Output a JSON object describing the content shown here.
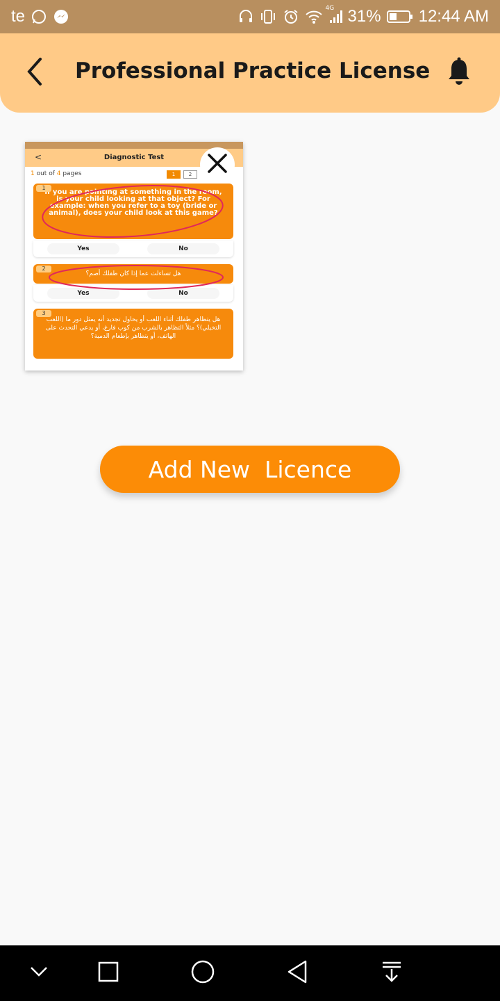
{
  "status_bar": {
    "carrier": "te",
    "network": "4G",
    "battery": "31%",
    "time": "12:44 AM",
    "left_icons": [
      "whatsapp-icon",
      "messenger-icon"
    ],
    "right_icons": [
      "headset-icon",
      "vibrate-icon",
      "alarm-icon",
      "wifi-icon",
      "signal-icon",
      "battery-icon"
    ]
  },
  "header": {
    "title": "Professional Practice License",
    "back_icon": "chevron-left-icon",
    "notification_icon": "bell-icon",
    "background": "#ffca87"
  },
  "license_thumbnail": {
    "title": "Diagnostic Test",
    "back": "<",
    "pager": {
      "current": "1",
      "middle": " out of ",
      "total": "4",
      "suffix": " pages",
      "pages": [
        "1",
        "2"
      ]
    },
    "questions": [
      {
        "number": "1",
        "text": "If you are pointing at something in the room, is your child looking at that object? For example: when you refer to a toy (bride or animal), does your child look at this game?",
        "answers": [
          "Yes",
          "No"
        ]
      },
      {
        "number": "2",
        "text": "هل تساءلت عما إذا كان طفلك أصم؟",
        "answers": [
          "Yes",
          "No"
        ]
      },
      {
        "number": "3",
        "text": "هل يتظاهر طفلك أثناء اللعب أو يحاول تجديد أنه يمثل دور ما (اللعب التخيلي)؟ مثلاً التظاهر بالشرب من كوب فارغ، أو يدعي التحدث على الهاتف، أو يتظاهر بإطعام الدمية؟"
      }
    ],
    "close_icon": "close-icon"
  },
  "add_button": {
    "label": "Add New  Licence",
    "color": "#fc8c06"
  },
  "nav_bar": {
    "items": [
      "chevron-down-icon",
      "square-icon",
      "circle-home-icon",
      "triangle-back-icon",
      "download-icon"
    ]
  }
}
